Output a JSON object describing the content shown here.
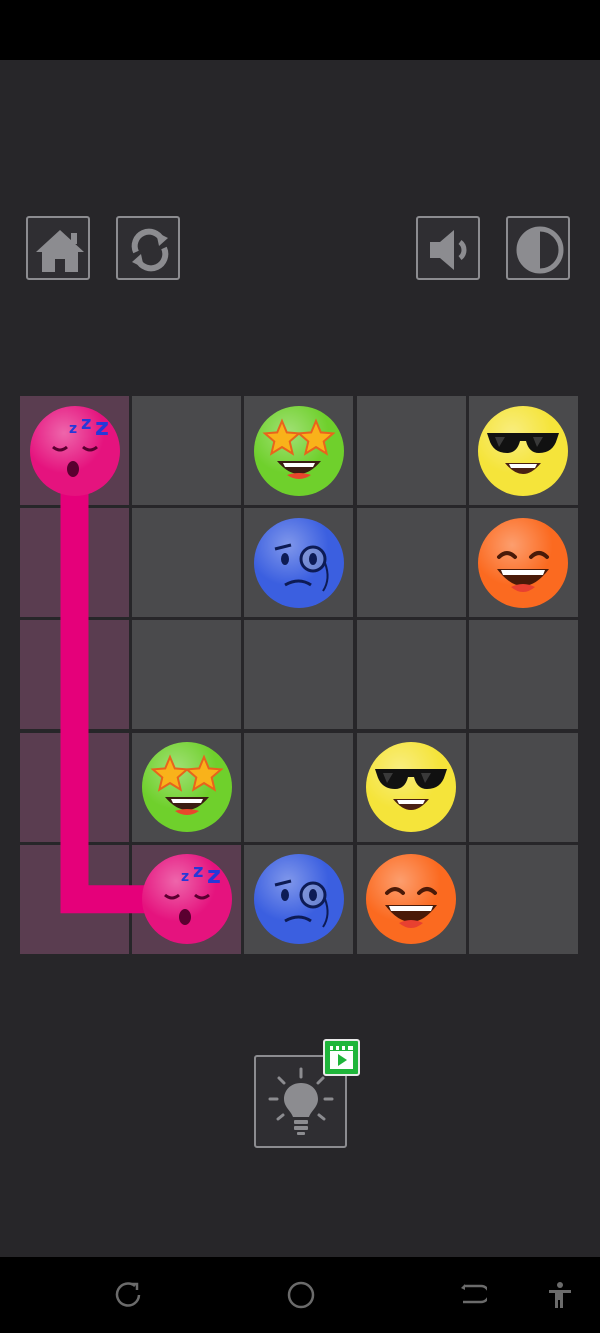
{
  "toolbar": {
    "home": "home-icon",
    "restart": "restart-icon",
    "sound": "sound-icon",
    "theme": "contrast-icon",
    "border_color": "#8c8c90"
  },
  "board": {
    "rows": 5,
    "cols": 5,
    "cell_color": "#4a4a4c",
    "filled_cell_color": "#5a3d50",
    "path_color": "#e5007a",
    "grid": [
      [
        "sleepy",
        "",
        "star-eyes",
        "",
        "cool"
      ],
      [
        "",
        "",
        "monocle",
        "",
        "grin"
      ],
      [
        "",
        "",
        "",
        "",
        ""
      ],
      [
        "",
        "star-eyes",
        "",
        "cool",
        ""
      ],
      [
        "",
        "sleepy",
        "monocle",
        "grin",
        ""
      ]
    ],
    "connected_path": [
      [
        0,
        0
      ],
      [
        1,
        0
      ],
      [
        2,
        0
      ],
      [
        3,
        0
      ],
      [
        4,
        0
      ],
      [
        4,
        1
      ]
    ],
    "filled_cells": [
      [
        0,
        0
      ],
      [
        1,
        0
      ],
      [
        2,
        0
      ],
      [
        3,
        0
      ],
      [
        4,
        0
      ],
      [
        4,
        1
      ]
    ]
  },
  "emoji_colors": {
    "sleepy": "#e5137e",
    "star-eyes": "#6fd02c",
    "monocle": "#3b5fe0",
    "cool": "#f5e43a",
    "grin": "#fb6a20"
  },
  "hint": {
    "icon": "lightbulb-icon",
    "badge_icon": "video-play-icon",
    "badge_color": "#1fb53a"
  },
  "nav_bar": {
    "recent": "recent-apps-icon",
    "home": "circle-home-icon",
    "back": "back-icon",
    "accessibility": "accessibility-icon"
  }
}
